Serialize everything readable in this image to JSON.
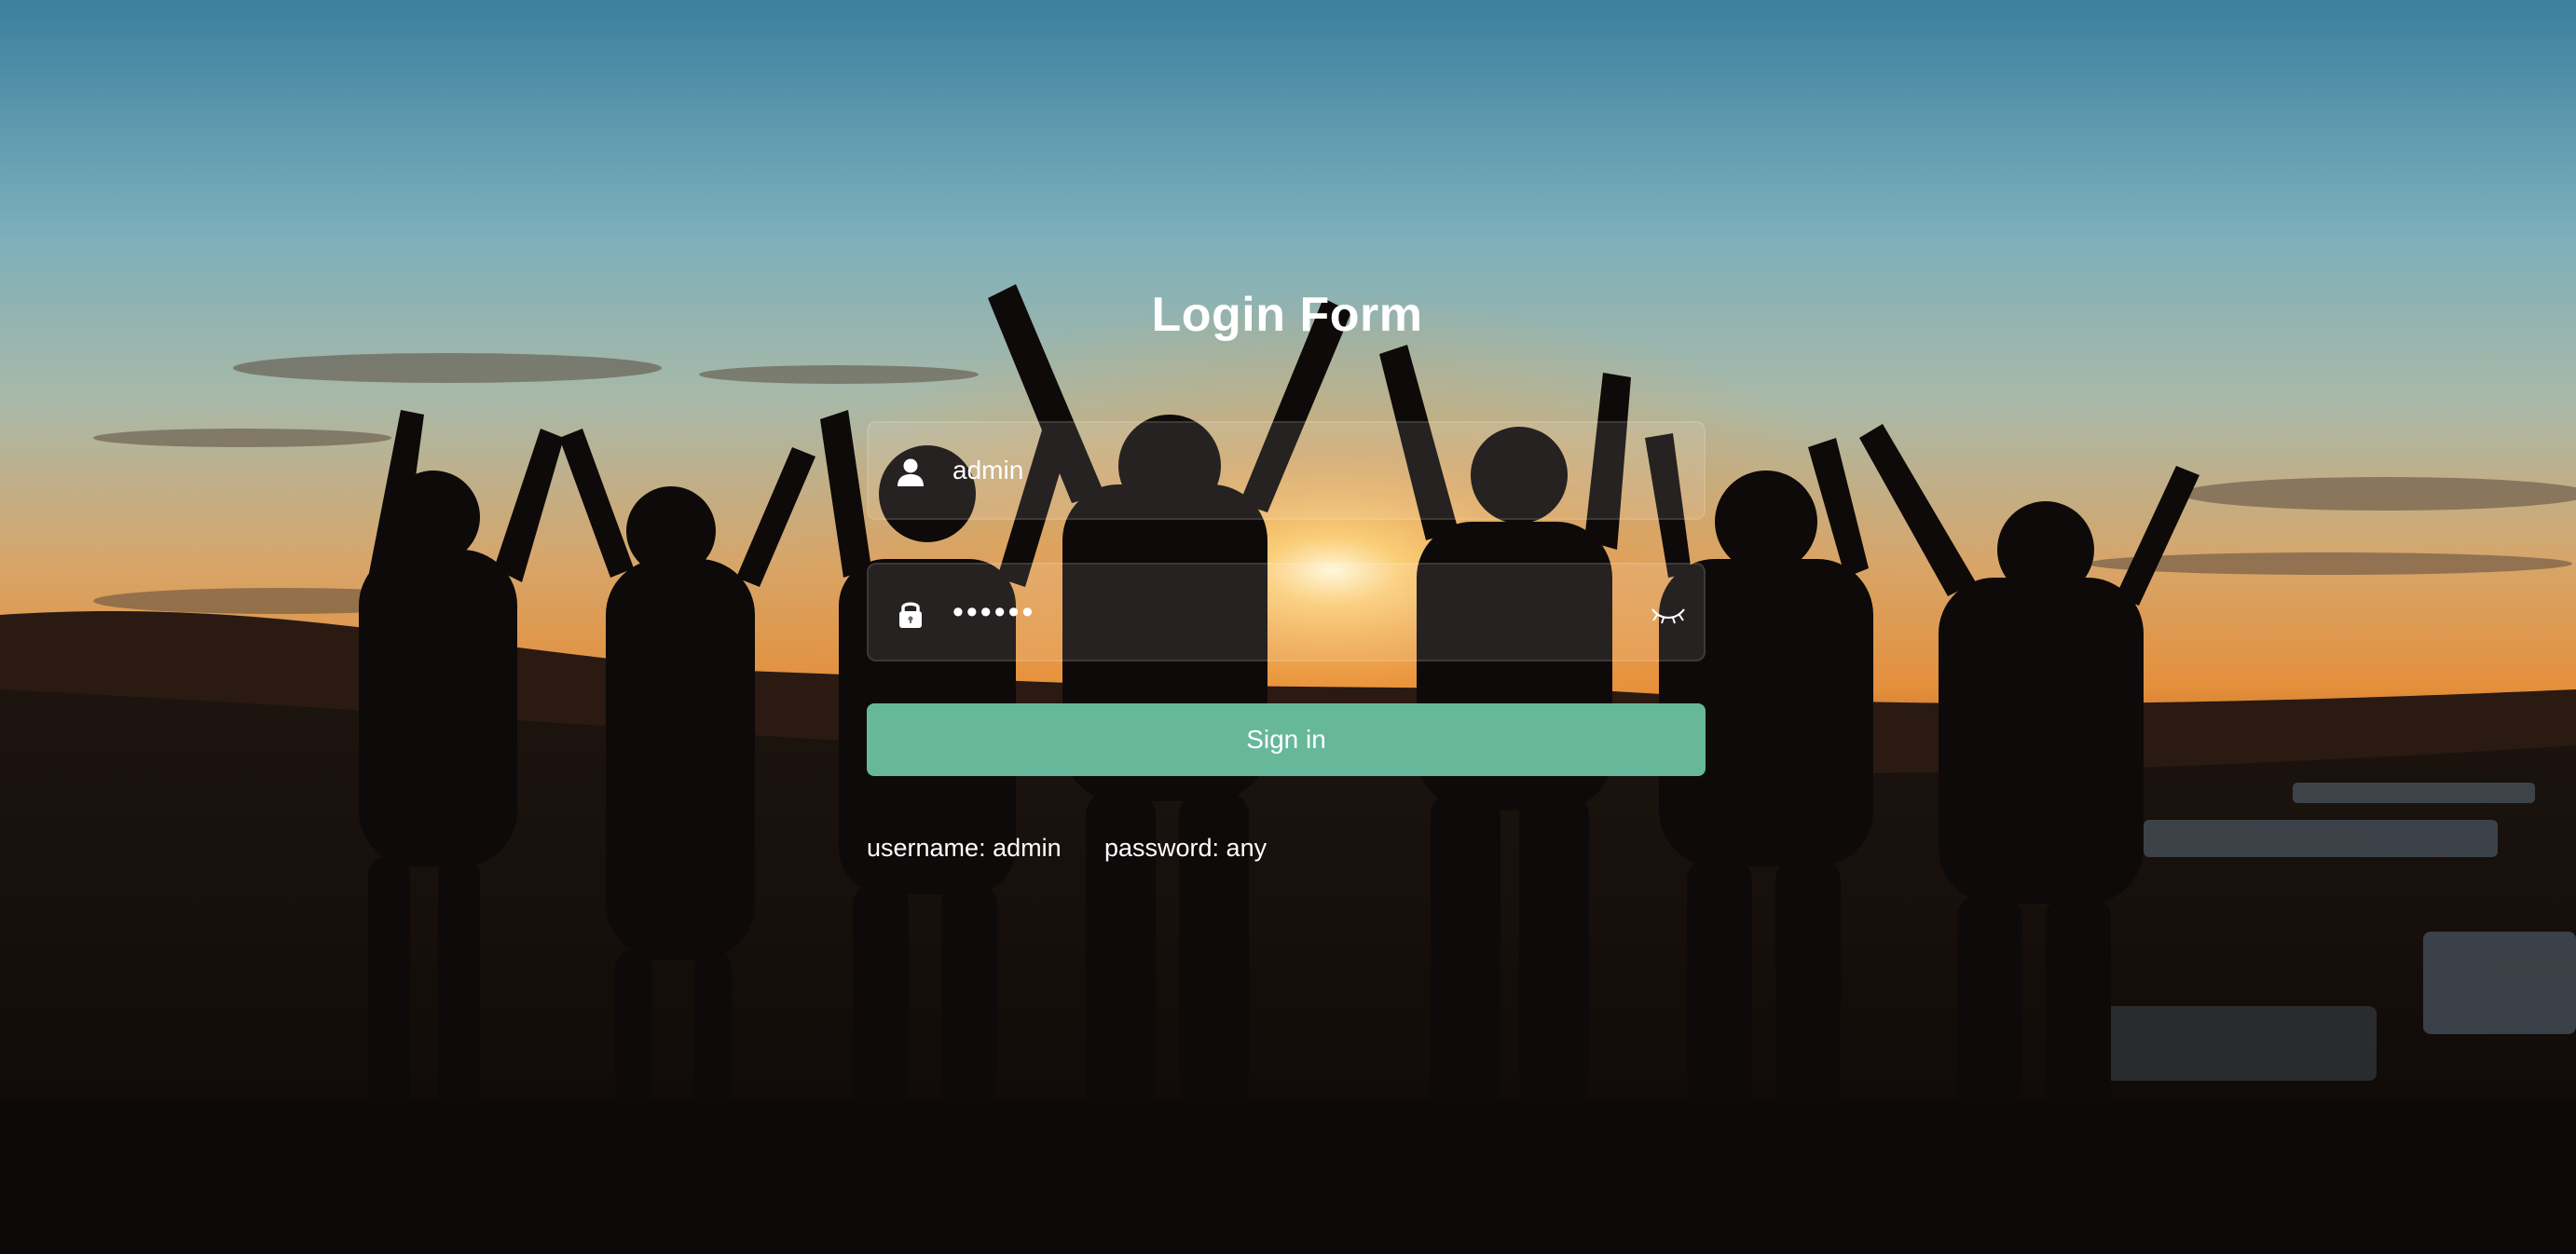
{
  "form": {
    "title": "Login Form",
    "username_value": "admin",
    "password_value": "••••••",
    "signin_label": "Sign in",
    "hint_username": "username: admin",
    "hint_password": "password: any"
  },
  "icons": {
    "username": "user-icon",
    "password": "lock-icon",
    "toggle": "eye-closed-icon"
  },
  "colors": {
    "accent": "#67b89b",
    "text": "#ffffff"
  }
}
